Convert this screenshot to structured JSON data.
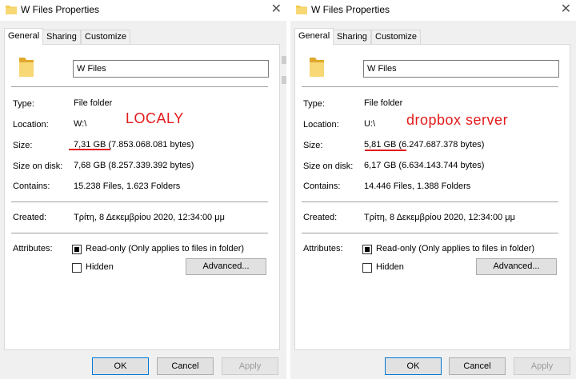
{
  "colors": {
    "annotation": "#e31b1b",
    "folder": "#f3c84a"
  },
  "dialogs": [
    {
      "title": "W Files Properties",
      "tabs": [
        "General",
        "Sharing",
        "Customize"
      ],
      "name": "W Files",
      "type_label": "Type:",
      "type_value": "File folder",
      "location_label": "Location:",
      "location_value": "W:\\",
      "size_label": "Size:",
      "size_value": "7,31 GB (7.853.068.081 bytes)",
      "size_on_disk_label": "Size on disk:",
      "size_on_disk_value": "7,68 GB (8.257.339.392 bytes)",
      "contains_label": "Contains:",
      "contains_value": "15.238 Files, 1.623 Folders",
      "created_label": "Created:",
      "created_value": "Τρίτη, 8 Δεκεμβρίου 2020, 12:34:00 μμ",
      "attributes_label": "Attributes:",
      "readonly_label": "Read-only (Only applies to files in folder)",
      "hidden_label": "Hidden",
      "advanced_label": "Advanced...",
      "ok_label": "OK",
      "cancel_label": "Cancel",
      "apply_label": "Apply",
      "annotation": "LOCALY"
    },
    {
      "title": "W Files Properties",
      "tabs": [
        "General",
        "Sharing",
        "Customize"
      ],
      "name": "W Files",
      "type_label": "Type:",
      "type_value": "File folder",
      "location_label": "Location:",
      "location_value": "U:\\",
      "size_label": "Size:",
      "size_value": "5,81 GB (6.247.687.378 bytes)",
      "size_on_disk_label": "Size on disk:",
      "size_on_disk_value": "6,17 GB (6.634.143.744 bytes)",
      "contains_label": "Contains:",
      "contains_value": "14.446 Files, 1.388 Folders",
      "created_label": "Created:",
      "created_value": "Τρίτη, 8 Δεκεμβρίου 2020, 12:34:00 μμ",
      "attributes_label": "Attributes:",
      "readonly_label": "Read-only (Only applies to files in folder)",
      "hidden_label": "Hidden",
      "advanced_label": "Advanced...",
      "ok_label": "OK",
      "cancel_label": "Cancel",
      "apply_label": "Apply",
      "annotation": "dropbox server"
    }
  ]
}
